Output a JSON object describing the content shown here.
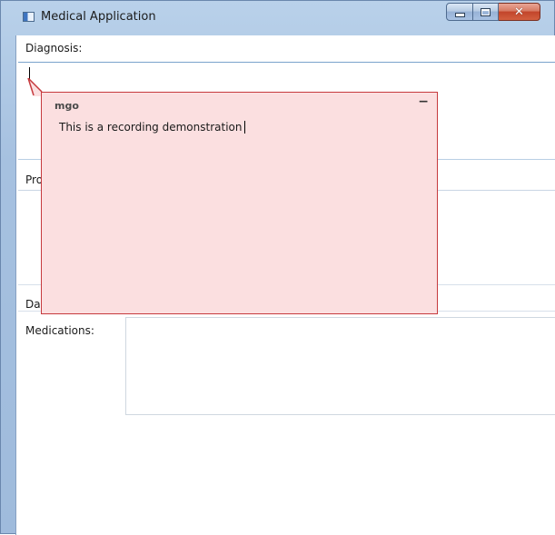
{
  "window": {
    "title": "Medical Application",
    "caption_buttons": {
      "minimize": "minimize-icon",
      "maximize": "maximize-icon",
      "close": "close-icon"
    }
  },
  "form": {
    "diagnosis_label": "Diagnosis:",
    "diagnosis_value": "",
    "procedures_label_partial": "Pro",
    "date_label_partial": "Da",
    "medications_label": "Medications:",
    "medications_value": ""
  },
  "note": {
    "author": "mgo",
    "collapse_glyph": "−",
    "text": "This is a recording demonstration",
    "background_color": "#fbdfe0",
    "border_color": "#c63a3e"
  }
}
